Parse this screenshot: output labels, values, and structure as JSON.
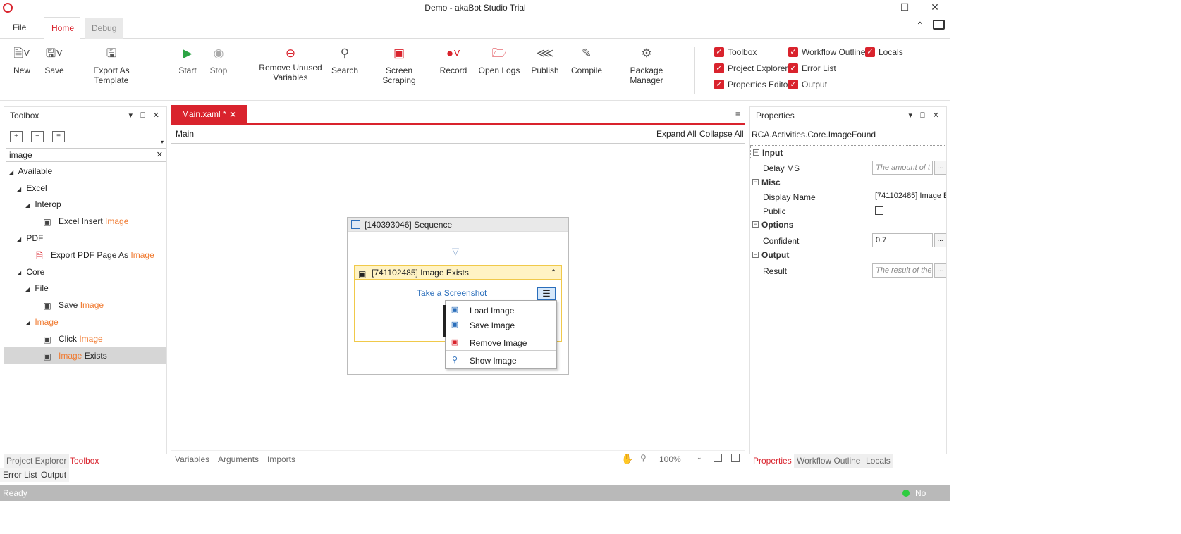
{
  "window": {
    "title": "Demo - akaBot Studio Trial"
  },
  "ribbon_tabs": {
    "file": "File",
    "home": "Home",
    "debug": "Debug"
  },
  "ribbon": {
    "new": "New",
    "save": "Save",
    "export_template": "Export As Template",
    "start": "Start",
    "stop": "Stop",
    "remove_unused_1": "Remove Unused",
    "remove_unused_2": "Variables",
    "search": "Search",
    "screen_scraping": "Screen Scraping",
    "record": "Record",
    "open_logs": "Open Logs",
    "publish": "Publish",
    "compile": "Compile",
    "package_manager": "Package Manager"
  },
  "panels_toggle": {
    "toolbox": "Toolbox",
    "project_explorer": "Project Explorer",
    "properties_editor": "Properties Editor",
    "workflow_outline": "Workflow Outline",
    "error_list": "Error List",
    "output": "Output",
    "locals": "Locals"
  },
  "toolbox": {
    "title": "Toolbox",
    "search_value": "image",
    "tree": {
      "available": "Available",
      "excel": "Excel",
      "interop": "Interop",
      "excel_insert_prefix": "Excel Insert ",
      "excel_insert_hl": "Image",
      "pdf": "PDF",
      "export_pdf_prefix": "Export PDF Page As ",
      "export_pdf_hl": "Image",
      "core": "Core",
      "file": "File",
      "save_image_prefix": "Save ",
      "save_image_hl": "Image",
      "image_group": "Image",
      "click_image_prefix": "Click ",
      "click_image_hl": "Image",
      "image_exists_hl": "Image",
      "image_exists_suffix": " Exists"
    }
  },
  "left_bottom_tabs": {
    "project_explorer": "Project Explorer",
    "toolbox": "Toolbox"
  },
  "bottom_tabs": {
    "error_list": "Error List",
    "output": "Output"
  },
  "designer": {
    "doc_tab": "Main.xaml *",
    "breadcrumb": "Main",
    "expand_all": "Expand All",
    "collapse_all": "Collapse All",
    "sequence_title": "[140393046] Sequence",
    "activity_title": "[741102485] Image Exists",
    "take_screenshot": "Take a Screenshot",
    "menu": {
      "load": "Load Image",
      "save": "Save Image",
      "remove": "Remove Image",
      "show": "Show Image"
    },
    "bottom": {
      "variables": "Variables",
      "arguments": "Arguments",
      "imports": "Imports",
      "zoom": "100%"
    }
  },
  "properties": {
    "title": "Properties",
    "type": "RCA.Activities.Core.ImageFound",
    "sections": {
      "input": "Input",
      "misc": "Misc",
      "options": "Options",
      "output": "Output"
    },
    "delay_ms": {
      "label": "Delay MS",
      "placeholder": "The amount of t"
    },
    "display_name": {
      "label": "Display Name",
      "value": "[741102485] Image E"
    },
    "public": {
      "label": "Public"
    },
    "confident": {
      "label": "Confident",
      "value": "0.7"
    },
    "result": {
      "label": "Result",
      "placeholder": "The result of the"
    },
    "ellipsis": "...",
    "bottom_tabs": {
      "properties": "Properties",
      "workflow_outline": "Workflow Outline",
      "locals": "Locals"
    }
  },
  "status": {
    "left": "Ready",
    "right": "No Errors"
  },
  "colors": {
    "accent": "#d9232d",
    "highlight": "#f07b32",
    "status_bar": "#b9b9b9",
    "ok": "#2ecc40"
  }
}
